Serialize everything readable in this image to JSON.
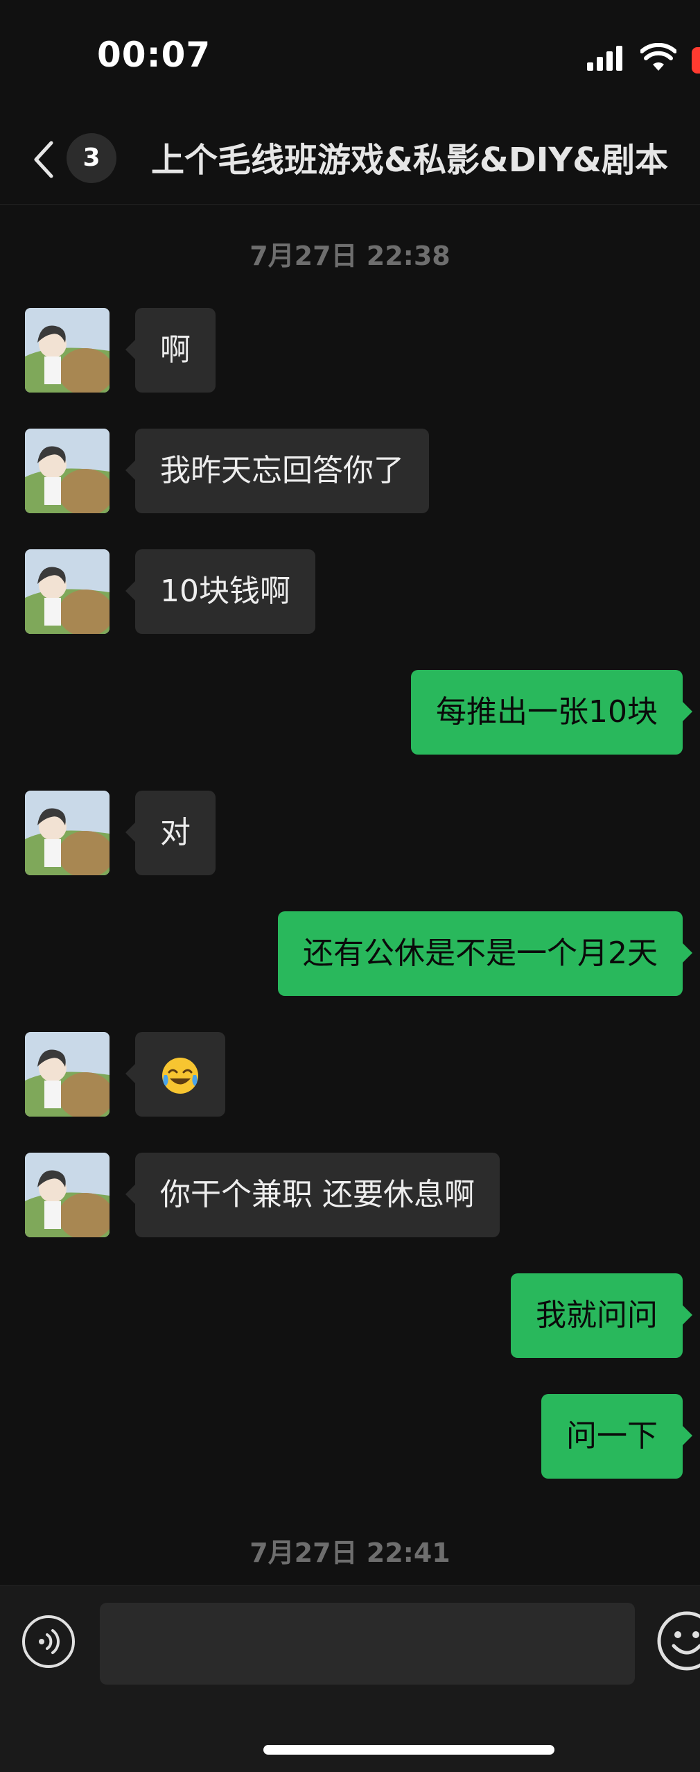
{
  "status_bar": {
    "time": "00:07"
  },
  "nav": {
    "unread_count": "3",
    "title": "上个毛线班游戏&私影&DIY&剧本"
  },
  "timestamps": [
    "7月27日 22:38",
    "7月27日 22:41"
  ],
  "messages": [
    {
      "sender": "other",
      "text": "啊"
    },
    {
      "sender": "other",
      "text": "我昨天忘回答你了"
    },
    {
      "sender": "other",
      "text": "10块钱啊"
    },
    {
      "sender": "me",
      "text": "每推出一张10块"
    },
    {
      "sender": "other",
      "text": "对"
    },
    {
      "sender": "me",
      "text": "还有公休是不是一个月2天"
    },
    {
      "sender": "other",
      "emoji": "face-with-tears-of-joy"
    },
    {
      "sender": "other",
      "text": "你干个兼职 还要休息啊"
    },
    {
      "sender": "me",
      "text": "我就问问"
    },
    {
      "sender": "me",
      "text": "问一下"
    }
  ],
  "input": {
    "value": "",
    "placeholder": ""
  },
  "colors": {
    "background": "#111111",
    "incoming_bubble": "#2c2c2c",
    "outgoing_bubble": "#29b85c",
    "battery_red": "#ff3b30"
  },
  "icons": {
    "back": "chevron-left-icon",
    "signal": "signal-icon",
    "wifi": "wifi-icon",
    "battery": "battery-icon",
    "voice": "voice-icon",
    "emoji": "emoji-icon"
  }
}
